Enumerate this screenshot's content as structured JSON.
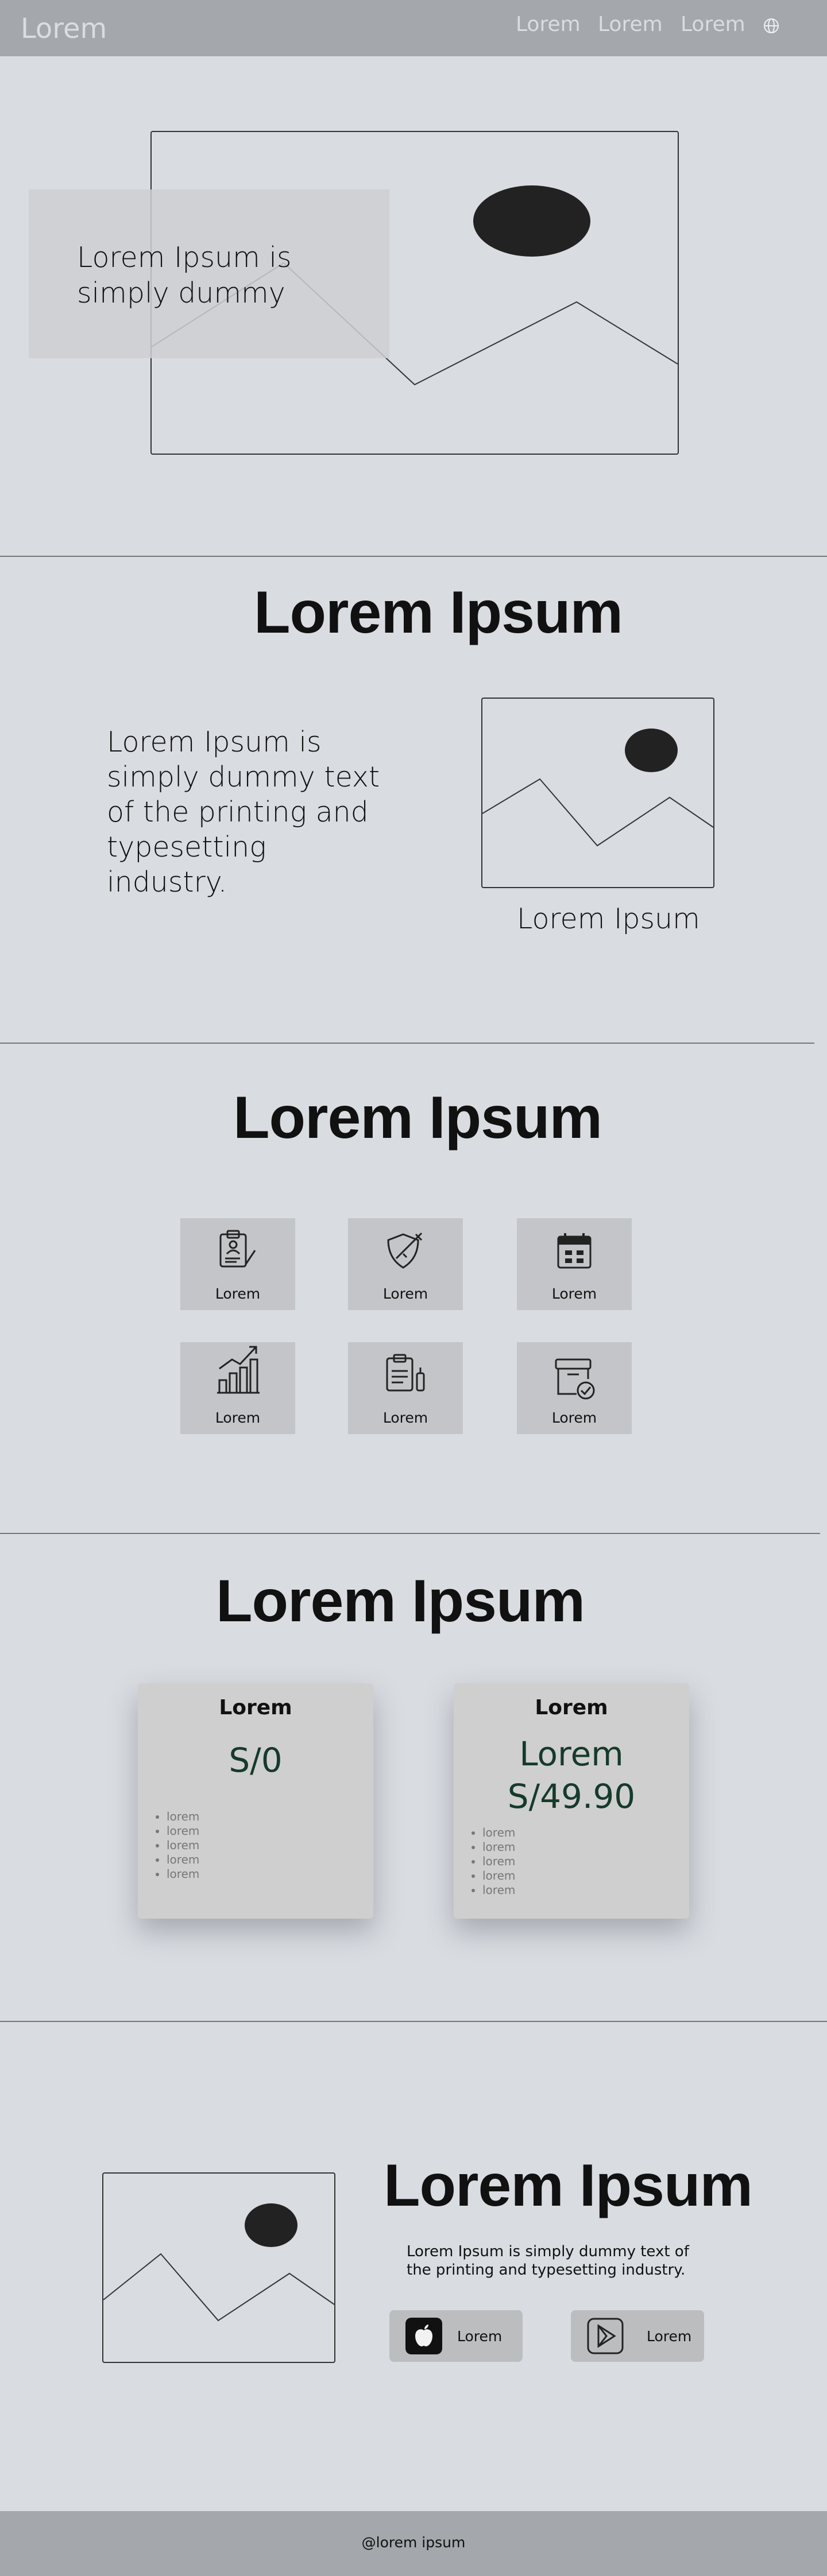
{
  "header": {
    "logo": "Lorem",
    "nav": [
      {
        "label": "Lorem"
      },
      {
        "label": "Lorem"
      },
      {
        "label": "Lorem"
      }
    ],
    "language_icon": "globe-icon"
  },
  "hero": {
    "line1": "Lorem Ipsum is",
    "line2": "simply dummy"
  },
  "about": {
    "title": "Lorem Ipsum",
    "text": "Lorem Ipsum is simply dummy text of the printing and typesetting industry.",
    "caption": "Lorem Ipsum"
  },
  "services": {
    "title": "Lorem Ipsum",
    "items": [
      {
        "label": "Lorem",
        "icon": "clipboard-user-icon"
      },
      {
        "label": "Lorem",
        "icon": "shield-syringe-icon"
      },
      {
        "label": "Lorem",
        "icon": "calendar-icon"
      },
      {
        "label": "Lorem",
        "icon": "bar-chart-growth-icon"
      },
      {
        "label": "Lorem",
        "icon": "prescription-clipboard-icon"
      },
      {
        "label": "Lorem",
        "icon": "box-check-icon"
      }
    ]
  },
  "pricing": {
    "title": "Lorem Ipsum",
    "plans": [
      {
        "name": "Lorem",
        "price": "S/0",
        "features": [
          "lorem",
          "lorem",
          "lorem",
          "lorem",
          "lorem"
        ]
      },
      {
        "name": "Lorem",
        "price_line1": "Lorem",
        "price_line2": "S/49.90",
        "features": [
          "lorem",
          "lorem",
          "lorem",
          "lorem",
          "lorem"
        ]
      }
    ]
  },
  "app": {
    "title": "Lorem Ipsum",
    "text": "Lorem Ipsum is simply dummy text of the printing and typesetting industry.",
    "stores": [
      {
        "label": "Lorem",
        "icon": "apple-icon"
      },
      {
        "label": "Lorem",
        "icon": "play-store-icon"
      }
    ]
  },
  "footer": {
    "text": "@lorem ipsum"
  },
  "colors": {
    "header_bg": "#a4a7ab",
    "page_bg": "#d9dce1",
    "price": "#163a2c"
  }
}
